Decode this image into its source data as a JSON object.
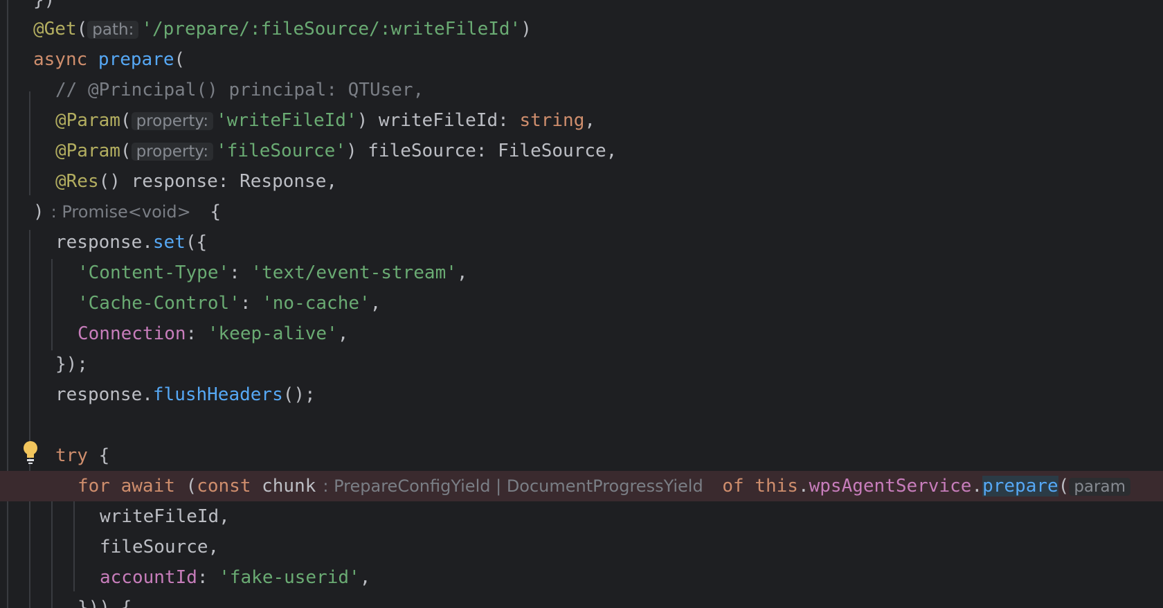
{
  "lines": [
    {
      "tokens": [
        {
          "t": "})",
          "c": "plain"
        }
      ]
    },
    {
      "tokens": [
        {
          "t": "@Get",
          "c": "ann"
        },
        {
          "t": "(",
          "c": "plain"
        },
        {
          "t": "path:",
          "c": "hint"
        },
        {
          "t": "'/prepare/:fileSource/:writeFileId'",
          "c": "str"
        },
        {
          "t": ")",
          "c": "plain"
        }
      ]
    },
    {
      "tokens": [
        {
          "t": "async ",
          "c": "kw"
        },
        {
          "t": "prepare",
          "c": "fn"
        },
        {
          "t": "(",
          "c": "plain"
        }
      ]
    },
    {
      "tokens": [
        {
          "t": "// @Principal() principal: QTUser,",
          "c": "cmt"
        }
      ]
    },
    {
      "tokens": [
        {
          "t": "@Param",
          "c": "ann"
        },
        {
          "t": "(",
          "c": "plain"
        },
        {
          "t": "property:",
          "c": "hint"
        },
        {
          "t": "'writeFileId'",
          "c": "str"
        },
        {
          "t": ") writeFileId: ",
          "c": "plain"
        },
        {
          "t": "string",
          "c": "kw"
        },
        {
          "t": ",",
          "c": "plain"
        }
      ]
    },
    {
      "tokens": [
        {
          "t": "@Param",
          "c": "ann"
        },
        {
          "t": "(",
          "c": "plain"
        },
        {
          "t": "property:",
          "c": "hint"
        },
        {
          "t": "'fileSource'",
          "c": "str"
        },
        {
          "t": ") fileSource: FileSource,",
          "c": "plain"
        }
      ]
    },
    {
      "tokens": [
        {
          "t": "@Res",
          "c": "ann"
        },
        {
          "t": "() response: Response,",
          "c": "plain"
        }
      ]
    },
    {
      "tokens": [
        {
          "t": ")",
          "c": "plain"
        },
        {
          "t": ": Promise<void>",
          "c": "thint"
        },
        {
          "t": " {",
          "c": "plain"
        }
      ]
    },
    {
      "tokens": [
        {
          "t": "response.",
          "c": "plain"
        },
        {
          "t": "set",
          "c": "fn"
        },
        {
          "t": "({",
          "c": "plain"
        }
      ]
    },
    {
      "tokens": [
        {
          "t": "'Content-Type'",
          "c": "str"
        },
        {
          "t": ": ",
          "c": "plain"
        },
        {
          "t": "'text/event-stream'",
          "c": "str"
        },
        {
          "t": ",",
          "c": "plain"
        }
      ]
    },
    {
      "tokens": [
        {
          "t": "'Cache-Control'",
          "c": "str"
        },
        {
          "t": ": ",
          "c": "plain"
        },
        {
          "t": "'no-cache'",
          "c": "str"
        },
        {
          "t": ",",
          "c": "plain"
        }
      ]
    },
    {
      "tokens": [
        {
          "t": "Connection",
          "c": "prop"
        },
        {
          "t": ": ",
          "c": "plain"
        },
        {
          "t": "'keep-alive'",
          "c": "str"
        },
        {
          "t": ",",
          "c": "plain"
        }
      ]
    },
    {
      "tokens": [
        {
          "t": "});",
          "c": "plain"
        }
      ]
    },
    {
      "tokens": [
        {
          "t": "response.",
          "c": "plain"
        },
        {
          "t": "flushHeaders",
          "c": "fn"
        },
        {
          "t": "();",
          "c": "plain"
        }
      ]
    },
    {
      "tokens": []
    },
    {
      "tokens": [
        {
          "t": "try ",
          "c": "kw"
        },
        {
          "t": "{",
          "c": "plain"
        }
      ]
    },
    {
      "tokens": [
        {
          "t": "for await ",
          "c": "kw"
        },
        {
          "t": "(",
          "c": "plain"
        },
        {
          "t": "const ",
          "c": "kw"
        },
        {
          "t": "chunk",
          "c": "plain"
        },
        {
          "t": ": PrepareConfigYield | DocumentProgressYield",
          "c": "thint"
        },
        {
          "t": " of ",
          "c": "kw"
        },
        {
          "t": "this",
          "c": "kw"
        },
        {
          "t": ".",
          "c": "plain"
        },
        {
          "t": "wpsAgentService",
          "c": "prop"
        },
        {
          "t": ".",
          "c": "plain"
        },
        {
          "t": "prepare",
          "c": "fn match"
        },
        {
          "t": "(",
          "c": "plain"
        },
        {
          "t": "param",
          "c": "hint"
        }
      ]
    },
    {
      "tokens": [
        {
          "t": "writeFileId,",
          "c": "plain"
        }
      ]
    },
    {
      "tokens": [
        {
          "t": "fileSource,",
          "c": "plain"
        }
      ]
    },
    {
      "tokens": [
        {
          "t": "accountId",
          "c": "prop"
        },
        {
          "t": ": ",
          "c": "plain"
        },
        {
          "t": "'fake-userid'",
          "c": "str"
        },
        {
          "t": ",",
          "c": "plain"
        }
      ]
    },
    {
      "tokens": [
        {
          "t": "})) {",
          "c": "plain"
        }
      ]
    }
  ]
}
